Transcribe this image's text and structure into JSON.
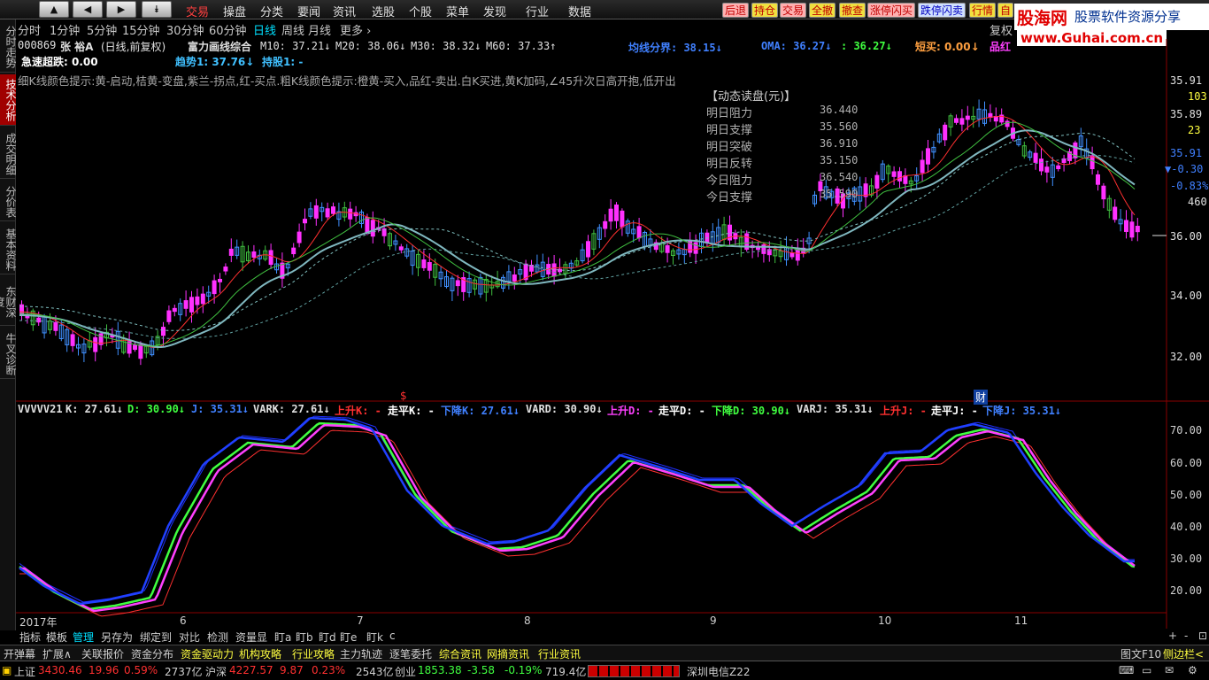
{
  "toolbar": {
    "menu": [
      "交易",
      "操盘",
      "分类",
      "要闻",
      "资讯",
      "选股",
      "个股",
      "菜单",
      "发现",
      "行业",
      "数据"
    ],
    "right_buttons": [
      "后退",
      "持仓",
      "交易",
      "全撤",
      "撤查",
      "涨停闪买",
      "跌停闪卖",
      "行情",
      "自"
    ],
    "logo_main": "股海网",
    "logo_sub": "股票软件资源分享",
    "logo_url": "www.Guhai.com.cn"
  },
  "left_tabs": [
    "分时走势",
    "技术分析",
    "成交明细",
    "分价表",
    "基本资料",
    "东财深度",
    "牛叉诊断"
  ],
  "periods": [
    "分时",
    "1分钟",
    "5分钟",
    "15分钟",
    "30分钟",
    "60分钟",
    "日线",
    "周线",
    "月线",
    "更多 ›"
  ],
  "active_period": "日线",
  "fuquan": "复权",
  "stock": {
    "code": "000869",
    "name": "张 裕A",
    "desc": "(日线,前复权)",
    "formula": "富力画线综合",
    "ma10": "M10: 37.21↓",
    "ma20": "M20: 38.06↓",
    "ma30": "M30: 38.32↓",
    "ma60": "M60: 37.33↑",
    "junxian": "均线分界: 38.15↓",
    "oma": "OMA: 36.27↓",
    "colon_val": ": 36.27↓",
    "duanmai": "短买: 0.00↓",
    "pinhong": "品红",
    "jisu": "急速超跌: 0.00",
    "qushi": "趋势1: 37.76↓",
    "chigu": "持股1: -",
    "hint": "细K线颜色提示:黄-启动,桔黄-变盘,紫兰-拐点,红-买点.粗K线颜色提示:橙黄-买入,品红-卖出.白K买进,黄K加码,∠45升次日高开抱,低开出"
  },
  "dynamic": {
    "title": "【动态读盘(元)】",
    "rows": [
      {
        "k": "明日阻力",
        "v": "36.440"
      },
      {
        "k": "明日支撑",
        "v": "35.560"
      },
      {
        "k": "明日突破",
        "v": "36.910"
      },
      {
        "k": "明日反转",
        "v": "35.150"
      },
      {
        "k": "今日阻力",
        "v": "36.540"
      },
      {
        "k": "今日支撑",
        "v": "35.590"
      }
    ]
  },
  "price_axis": [
    "35.91",
    "103",
    "35.89",
    "23",
    "35.91",
    "▼-0.30",
    "-0.83%",
    "460",
    "36.00",
    "34.00",
    "32.00"
  ],
  "kdj_axis": [
    "70.00",
    "60.00",
    "50.00",
    "40.00",
    "30.00",
    "20.00"
  ],
  "x_axis": [
    "2017年",
    "6",
    "7",
    "8",
    "9",
    "10",
    "11"
  ],
  "markers": {
    "dollar": "$",
    "cai": "财"
  },
  "kdj_header": [
    {
      "t": "VVVVV21",
      "c": "#e0e0e0"
    },
    {
      "t": "K: 27.61↓",
      "c": "#e0e0e0"
    },
    {
      "t": "D: 30.90↓",
      "c": "#40ff40"
    },
    {
      "t": "J: 35.31↓",
      "c": "#4080ff"
    },
    {
      "t": "VARK: 27.61↓",
      "c": "#e0e0e0"
    },
    {
      "t": "上升K: -",
      "c": "#ff3030"
    },
    {
      "t": "走平K: -",
      "c": "#ffffff"
    },
    {
      "t": "下降K: 27.61↓",
      "c": "#4080ff"
    },
    {
      "t": "VARD: 30.90↓",
      "c": "#e0e0e0"
    },
    {
      "t": "上升D: -",
      "c": "#ff40ff"
    },
    {
      "t": "走平D: -",
      "c": "#ffffff"
    },
    {
      "t": "下降D: 30.90↓",
      "c": "#40ff40"
    },
    {
      "t": "VARJ: 35.31↓",
      "c": "#e0e0e0"
    },
    {
      "t": "上升J: -",
      "c": "#ff3030"
    },
    {
      "t": "走平J: -",
      "c": "#ffffff"
    },
    {
      "t": "下降J: 35.31↓",
      "c": "#4080ff"
    }
  ],
  "bottom_tools": [
    "指标",
    "模板",
    "管理",
    "另存为",
    "绑定到",
    "对比",
    "检测",
    "资量显",
    "盯a",
    "盯b",
    "盯d",
    "盯e",
    "盯k",
    "c"
  ],
  "bottom_right": [
    "+",
    "-",
    "⊡"
  ],
  "shortcuts": [
    {
      "t": "开弹幕",
      "y": false
    },
    {
      "t": "扩展∧",
      "y": false
    },
    {
      "t": "关联报价",
      "y": false
    },
    {
      "t": "资金分布",
      "y": false
    },
    {
      "t": "资金驱动力",
      "y": true
    },
    {
      "t": "机构攻略",
      "y": true
    },
    {
      "t": "行业攻略",
      "y": true
    },
    {
      "t": "主力轨迹",
      "y": false
    },
    {
      "t": "逐笔委托",
      "y": false
    },
    {
      "t": "综合资讯",
      "y": true
    },
    {
      "t": "网摘资讯",
      "y": true
    },
    {
      "t": "行业资讯",
      "y": true
    }
  ],
  "shortcut_right": [
    "图文F10",
    "侧边栏<"
  ],
  "status": {
    "sh_label": "上证",
    "sh_val": "3430.46",
    "sh_chg": "19.96",
    "sh_pct": "0.59%",
    "sh_amt": "2737亿",
    "sz_label": "沪深",
    "sz_val": "4227.57",
    "sz_chg": "9.87",
    "sz_pct": "0.23%",
    "sz_amt": "2543亿",
    "cy_label": "创业",
    "cy_val": "1853.38",
    "cy_chg": "-3.58",
    "cy_pct": "-0.19%",
    "cy_amt": "719.4亿",
    "broker": "深圳电信Z22"
  }
}
